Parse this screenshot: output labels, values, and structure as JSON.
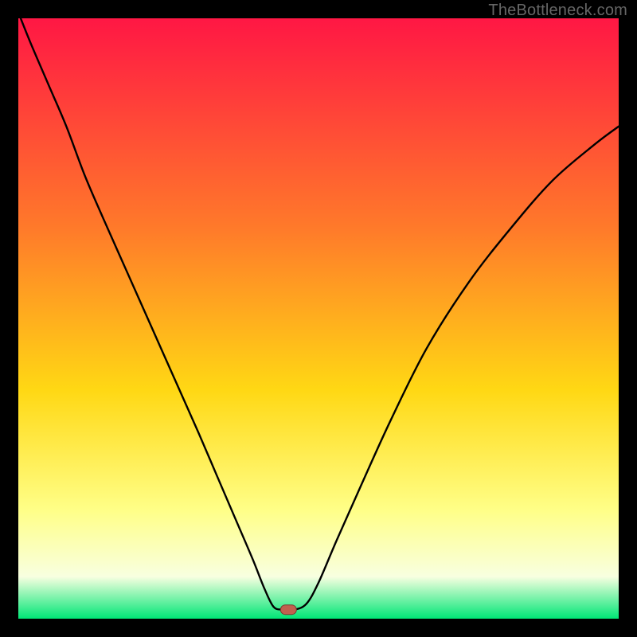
{
  "attribution": "TheBottleneck.com",
  "colors": {
    "frame": "#000000",
    "gradient_top": "#ff1744",
    "gradient_mid_upper": "#ff7a2a",
    "gradient_mid": "#ffd814",
    "gradient_mid_lower": "#ffff88",
    "gradient_lower": "#f8ffe0",
    "gradient_bottom": "#00e676",
    "curve": "#000000",
    "marker_fill": "#c1604f",
    "marker_stroke": "#7a3a30"
  },
  "chart_data": {
    "type": "line",
    "xlim": [
      0,
      100
    ],
    "ylim": [
      0,
      100
    ],
    "x": [
      0,
      2,
      5,
      8,
      11,
      14,
      18,
      22,
      26,
      30,
      33,
      36,
      39,
      41,
      42.5,
      44,
      46,
      48,
      50,
      53,
      57,
      62,
      68,
      75,
      82,
      89,
      96,
      100
    ],
    "y": [
      101,
      96,
      89,
      82,
      74,
      67,
      58,
      49,
      40,
      31,
      24,
      17,
      10,
      5,
      2,
      1.5,
      1.5,
      2.5,
      6,
      13,
      22,
      33,
      45,
      56,
      65,
      73,
      79,
      82
    ],
    "marker": {
      "x": 45,
      "y": 1.5
    },
    "title": "",
    "xlabel": "",
    "ylabel": ""
  }
}
